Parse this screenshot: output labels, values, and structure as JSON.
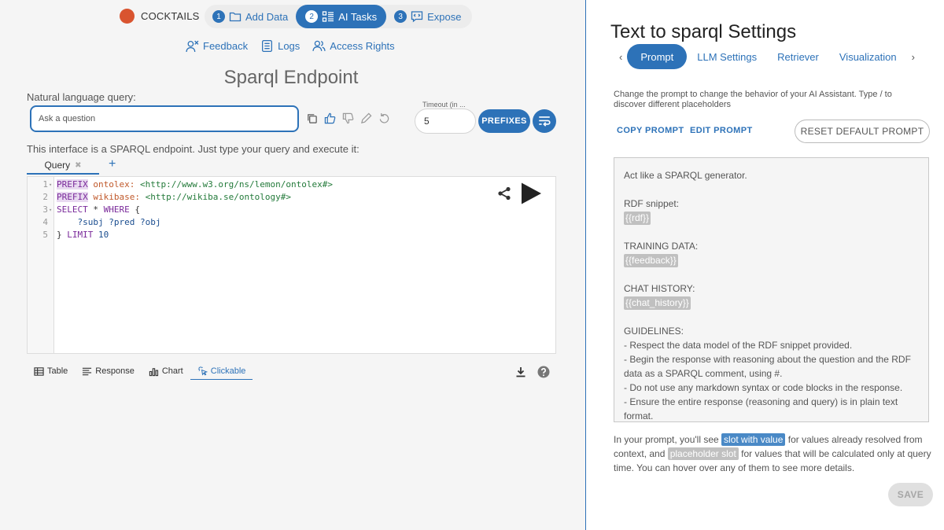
{
  "brand": {
    "label": "COCKTAILS",
    "color": "#d9542f"
  },
  "stepper": [
    {
      "num": "1",
      "label": "Add Data",
      "icon": "folder-icon"
    },
    {
      "num": "2",
      "label": "AI Tasks",
      "icon": "list-icon",
      "active": true
    },
    {
      "num": "3",
      "label": "Expose",
      "icon": "chat-code-icon"
    }
  ],
  "subnav": [
    {
      "label": "Feedback",
      "icon": "feedback-icon"
    },
    {
      "label": "Logs",
      "icon": "logs-icon"
    },
    {
      "label": "Access Rights",
      "icon": "users-icon"
    }
  ],
  "page_title": "Sparql Endpoint",
  "nlq": {
    "label": "Natural language query:",
    "placeholder": "Ask a question"
  },
  "timeout": {
    "label": "Timeout (in ...",
    "value": "5"
  },
  "prefixes_label": "PREFIXES",
  "intro": "This interface is a SPARQL endpoint. Just type your query and execute it:",
  "query_tab": {
    "label": "Query",
    "close": "✖",
    "add": "+"
  },
  "editor": {
    "lines": [
      {
        "n": "1",
        "fold": "▾",
        "parts": [
          {
            "t": "PREFIX",
            "c": "kw-hl"
          },
          {
            "t": " ",
            "c": ""
          },
          {
            "t": "ontolex:",
            "c": "pfx"
          },
          {
            "t": " ",
            "c": ""
          },
          {
            "t": "<http://www.w3.org/ns/lemon/ontolex#>",
            "c": "iri"
          }
        ]
      },
      {
        "n": "2",
        "fold": "",
        "parts": [
          {
            "t": "PREFIX",
            "c": "kw-hl"
          },
          {
            "t": " ",
            "c": ""
          },
          {
            "t": "wikibase:",
            "c": "pfx"
          },
          {
            "t": " ",
            "c": ""
          },
          {
            "t": "<http://wikiba.se/ontology#>",
            "c": "iri"
          }
        ]
      },
      {
        "n": "3",
        "fold": "▾",
        "parts": [
          {
            "t": "SELECT",
            "c": "kw"
          },
          {
            "t": " * ",
            "c": ""
          },
          {
            "t": "WHERE",
            "c": "kw"
          },
          {
            "t": " {",
            "c": ""
          }
        ]
      },
      {
        "n": "4",
        "fold": "",
        "parts": [
          {
            "t": "    ?subj ?pred ?obj",
            "c": "var"
          }
        ]
      },
      {
        "n": "5",
        "fold": "",
        "parts": [
          {
            "t": "} ",
            "c": ""
          },
          {
            "t": "LIMIT",
            "c": "kw"
          },
          {
            "t": " ",
            "c": ""
          },
          {
            "t": "10",
            "c": "num"
          }
        ]
      }
    ]
  },
  "result_tabs": [
    {
      "label": "Table",
      "icon": "table-icon"
    },
    {
      "label": "Response",
      "icon": "response-icon"
    },
    {
      "label": "Chart",
      "icon": "chart-icon"
    },
    {
      "label": "Clickable",
      "icon": "click-icon",
      "active": true
    }
  ],
  "settings": {
    "title": "Text to sparql Settings",
    "tabs": [
      {
        "label": "Prompt",
        "active": true
      },
      {
        "label": "LLM Settings"
      },
      {
        "label": "Retriever"
      },
      {
        "label": "Visualization"
      }
    ],
    "description": "Change the prompt to change the behavior of your AI Assistant. Type / to discover different placeholders",
    "copy_prompt": "COPY PROMPT",
    "edit_prompt": "EDIT PROMPT",
    "reset_prompt": "RESET DEFAULT PROMPT",
    "prompt": {
      "intro": "Act like a SPARQL generator.",
      "rdf_label": "RDF snippet:",
      "rdf_slot": "{{rdf}}",
      "training_label": "TRAINING DATA:",
      "training_slot": "{{feedback}}",
      "history_label": "CHAT HISTORY:",
      "history_slot": "{{chat_history}}",
      "guidelines_label": "GUIDELINES:",
      "guidelines": [
        "- Respect the data model of the RDF snippet provided.",
        "- Begin the response with reasoning about the question and the RDF data as a SPARQL comment, using #.",
        "- Do not use any markdown syntax or code blocks in the response.",
        "- Ensure the entire response (reasoning and query) is in plain text format."
      ]
    },
    "info": {
      "part1": "In your prompt, you'll see ",
      "chip_value": "slot with value",
      "part2": " for values already resolved from context, and ",
      "chip_placeholder": "placeholder slot",
      "part3": " for values that will be calculated only at query time. You can hover over any of them to see more details."
    },
    "save_label": "SAVE"
  },
  "colors": {
    "accent": "#2d72b8",
    "slot_value": "#4a89c6",
    "slot_placeholder": "#c0c0c0"
  }
}
